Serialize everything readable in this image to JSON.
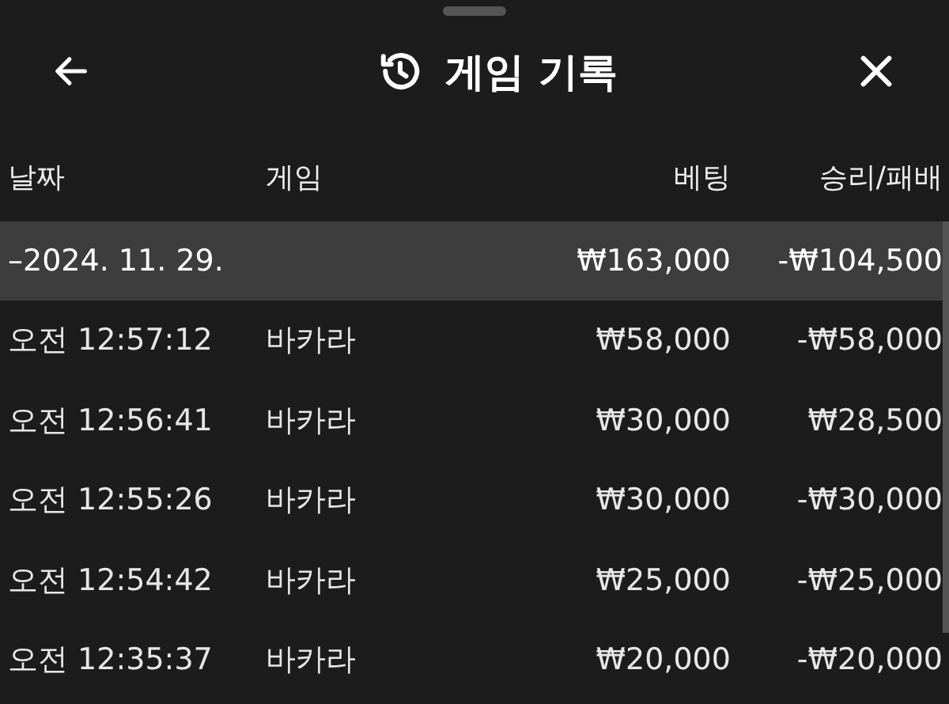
{
  "header": {
    "title": "게임 기록"
  },
  "table": {
    "columns": [
      "날짜",
      "게임",
      "베팅",
      "승리/패배"
    ],
    "group": {
      "date": "–2024. 11. 29.",
      "bet": "₩163,000",
      "result": "-₩104,500"
    },
    "rows": [
      {
        "time": "오전 12:57:12",
        "game": "바카라",
        "bet": "₩58,000",
        "result": "-₩58,000"
      },
      {
        "time": "오전 12:56:41",
        "game": "바카라",
        "bet": "₩30,000",
        "result": "₩28,500"
      },
      {
        "time": "오전 12:55:26",
        "game": "바카라",
        "bet": "₩30,000",
        "result": "-₩30,000"
      },
      {
        "time": "오전 12:54:42",
        "game": "바카라",
        "bet": "₩25,000",
        "result": "-₩25,000"
      },
      {
        "time": "오전 12:35:37",
        "game": "바카라",
        "bet": "₩20,000",
        "result": "-₩20,000"
      }
    ]
  }
}
